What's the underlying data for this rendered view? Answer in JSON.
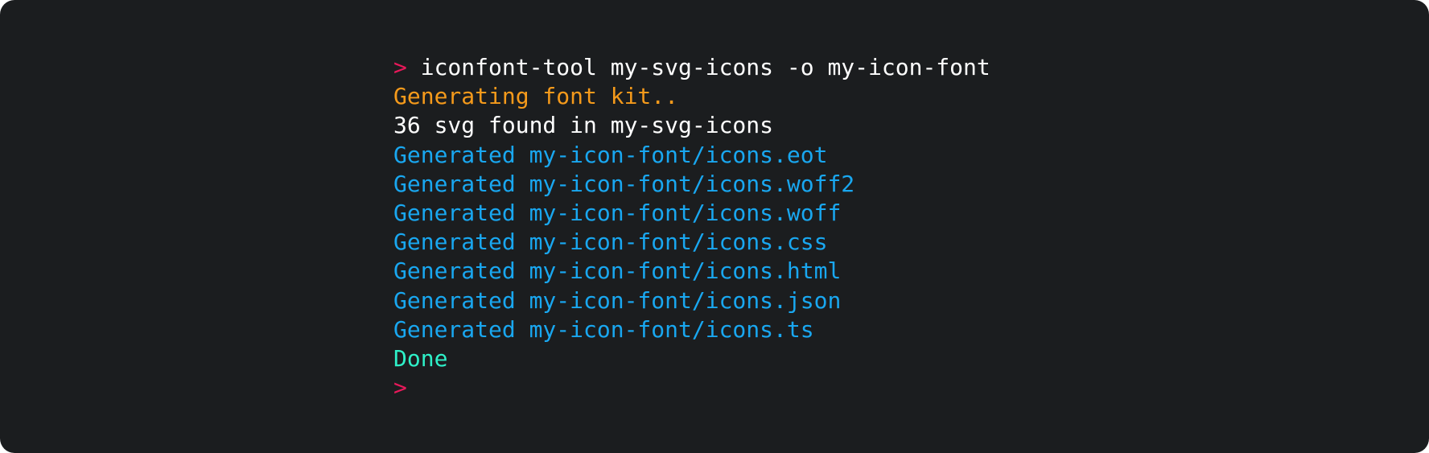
{
  "terminal": {
    "prompt_symbol": ">",
    "command": "iconfont-tool my-svg-icons -o my-icon-font",
    "output": {
      "status": "Generating font kit..",
      "found": "36 svg found in my-svg-icons",
      "generated": [
        "Generated my-icon-font/icons.eot",
        "Generated my-icon-font/icons.woff2",
        "Generated my-icon-font/icons.woff",
        "Generated my-icon-font/icons.css",
        "Generated my-icon-font/icons.html",
        "Generated my-icon-font/icons.json",
        "Generated my-icon-font/icons.ts"
      ],
      "done": "Done"
    }
  },
  "colors": {
    "background": "#1b1d1f",
    "prompt": "#e8195a",
    "command": "#ffffff",
    "status": "#f59a1b",
    "generated": "#19a7f0",
    "done": "#2ef0c8"
  }
}
